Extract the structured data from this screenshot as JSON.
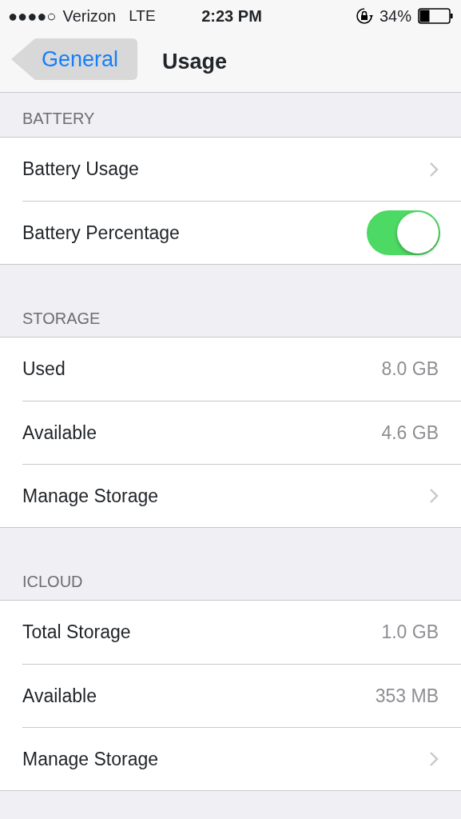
{
  "status_bar": {
    "signal": "●●●●○",
    "carrier": "Verizon",
    "network": "LTE",
    "time": "2:23 PM",
    "battery_percent": "34%"
  },
  "nav": {
    "back": "General",
    "back_pressed": true,
    "title": "Usage"
  },
  "sections": [
    {
      "header": "BATTERY",
      "rows": [
        {
          "kind": "link",
          "label": "Battery Usage"
        },
        {
          "kind": "toggle",
          "label": "Battery Percentage",
          "on": true
        }
      ]
    },
    {
      "header": "STORAGE",
      "rows": [
        {
          "kind": "value",
          "label": "Used",
          "value": "8.0 GB"
        },
        {
          "kind": "value",
          "label": "Available",
          "value": "4.6 GB"
        },
        {
          "kind": "link",
          "label": "Manage Storage"
        }
      ]
    },
    {
      "header": "ICLOUD",
      "rows": [
        {
          "kind": "value",
          "label": "Total Storage",
          "value": "1.0 GB"
        },
        {
          "kind": "value",
          "label": "Available",
          "value": "353 MB"
        },
        {
          "kind": "link",
          "label": "Manage Storage"
        }
      ]
    }
  ]
}
